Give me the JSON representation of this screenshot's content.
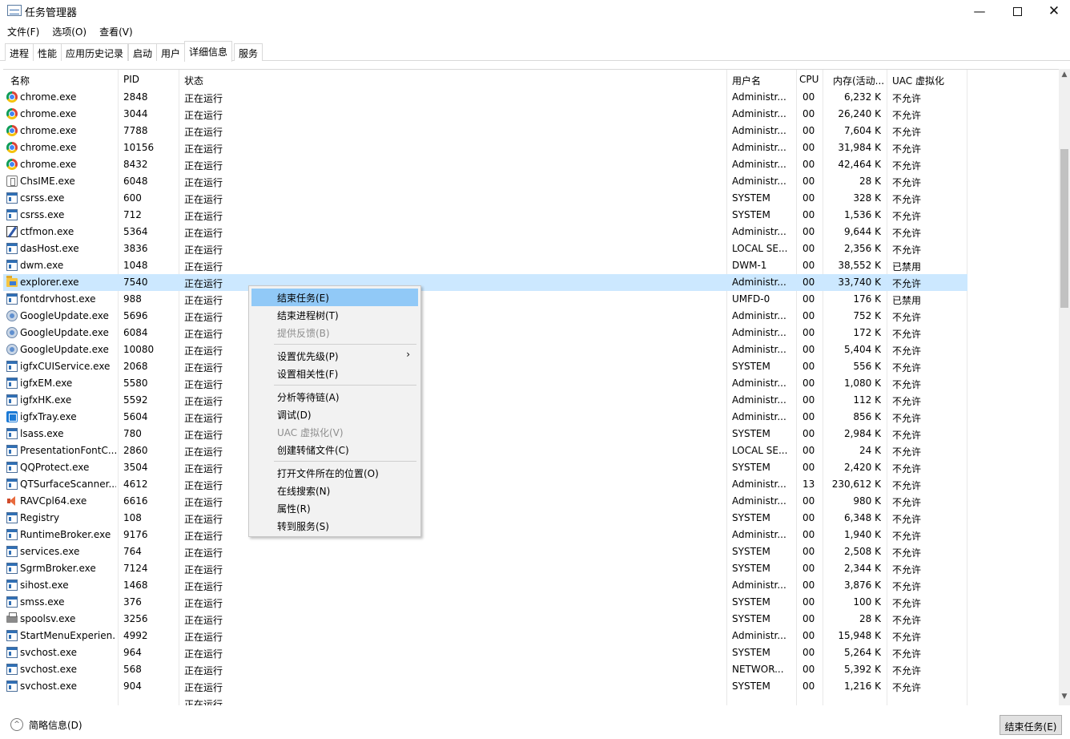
{
  "window": {
    "title": "任务管理器",
    "min_glyph": "—",
    "close_glyph": "✕"
  },
  "menu": [
    "文件(F)",
    "选项(O)",
    "查看(V)"
  ],
  "tabs": [
    "进程",
    "性能",
    "应用历史记录",
    "启动",
    "用户",
    "详细信息",
    "服务"
  ],
  "active_tab": "详细信息",
  "columns": {
    "name": "名称",
    "pid": "PID",
    "status": "状态",
    "user": "用户名",
    "cpu": "CPU",
    "mem": "内存(活动...",
    "uac": "UAC 虚拟化"
  },
  "sort_glyph": "^",
  "rows": [
    {
      "icon": "chrome-icon",
      "name": "chrome.exe",
      "pid": "2848",
      "status": "正在运行",
      "user": "Administr...",
      "cpu": "00",
      "mem": "6,232 K",
      "uac": "不允许"
    },
    {
      "icon": "chrome-icon",
      "name": "chrome.exe",
      "pid": "3044",
      "status": "正在运行",
      "user": "Administr...",
      "cpu": "00",
      "mem": "26,240 K",
      "uac": "不允许"
    },
    {
      "icon": "chrome-icon",
      "name": "chrome.exe",
      "pid": "7788",
      "status": "正在运行",
      "user": "Administr...",
      "cpu": "00",
      "mem": "7,604 K",
      "uac": "不允许"
    },
    {
      "icon": "chrome-icon",
      "name": "chrome.exe",
      "pid": "10156",
      "status": "正在运行",
      "user": "Administr...",
      "cpu": "00",
      "mem": "31,984 K",
      "uac": "不允许"
    },
    {
      "icon": "chrome-icon",
      "name": "chrome.exe",
      "pid": "8432",
      "status": "正在运行",
      "user": "Administr...",
      "cpu": "00",
      "mem": "42,464 K",
      "uac": "不允许"
    },
    {
      "icon": "ime-icon",
      "name": "ChsIME.exe",
      "pid": "6048",
      "status": "正在运行",
      "user": "Administr...",
      "cpu": "00",
      "mem": "28 K",
      "uac": "不允许"
    },
    {
      "icon": "app-window-icon",
      "name": "csrss.exe",
      "pid": "600",
      "status": "正在运行",
      "user": "SYSTEM",
      "cpu": "00",
      "mem": "328 K",
      "uac": "不允许"
    },
    {
      "icon": "app-window-icon",
      "name": "csrss.exe",
      "pid": "712",
      "status": "正在运行",
      "user": "SYSTEM",
      "cpu": "00",
      "mem": "1,536 K",
      "uac": "不允许"
    },
    {
      "icon": "ctfmon-icon",
      "name": "ctfmon.exe",
      "pid": "5364",
      "status": "正在运行",
      "user": "Administr...",
      "cpu": "00",
      "mem": "9,644 K",
      "uac": "不允许"
    },
    {
      "icon": "app-window-icon",
      "name": "dasHost.exe",
      "pid": "3836",
      "status": "正在运行",
      "user": "LOCAL SE...",
      "cpu": "00",
      "mem": "2,356 K",
      "uac": "不允许"
    },
    {
      "icon": "app-window-icon",
      "name": "dwm.exe",
      "pid": "1048",
      "status": "正在运行",
      "user": "DWM-1",
      "cpu": "00",
      "mem": "38,552 K",
      "uac": "已禁用"
    },
    {
      "icon": "explorer-folder-icon",
      "name": "explorer.exe",
      "pid": "7540",
      "status": "正在运行",
      "user": "Administr...",
      "cpu": "00",
      "mem": "33,740 K",
      "uac": "不允许",
      "selected": true
    },
    {
      "icon": "app-window-icon",
      "name": "fontdrvhost.exe",
      "pid": "988",
      "status": "正在运行",
      "user": "UMFD-0",
      "cpu": "00",
      "mem": "176 K",
      "uac": "已禁用"
    },
    {
      "icon": "google-update-icon",
      "name": "GoogleUpdate.exe",
      "pid": "5696",
      "status": "正在运行",
      "user": "Administr...",
      "cpu": "00",
      "mem": "752 K",
      "uac": "不允许"
    },
    {
      "icon": "google-update-icon",
      "name": "GoogleUpdate.exe",
      "pid": "6084",
      "status": "正在运行",
      "user": "Administr...",
      "cpu": "00",
      "mem": "172 K",
      "uac": "不允许"
    },
    {
      "icon": "google-update-icon",
      "name": "GoogleUpdate.exe",
      "pid": "10080",
      "status": "正在运行",
      "user": "Administr...",
      "cpu": "00",
      "mem": "5,404 K",
      "uac": "不允许"
    },
    {
      "icon": "app-window-icon",
      "name": "igfxCUIService.exe",
      "pid": "2068",
      "status": "正在运行",
      "user": "SYSTEM",
      "cpu": "00",
      "mem": "556 K",
      "uac": "不允许"
    },
    {
      "icon": "app-window-icon",
      "name": "igfxEM.exe",
      "pid": "5580",
      "status": "正在运行",
      "user": "Administr...",
      "cpu": "00",
      "mem": "1,080 K",
      "uac": "不允许"
    },
    {
      "icon": "app-window-icon",
      "name": "igfxHK.exe",
      "pid": "5592",
      "status": "正在运行",
      "user": "Administr...",
      "cpu": "00",
      "mem": "112 K",
      "uac": "不允许"
    },
    {
      "icon": "igfx-tray-icon",
      "name": "igfxTray.exe",
      "pid": "5604",
      "status": "正在运行",
      "user": "Administr...",
      "cpu": "00",
      "mem": "856 K",
      "uac": "不允许"
    },
    {
      "icon": "app-window-icon",
      "name": "lsass.exe",
      "pid": "780",
      "status": "正在运行",
      "user": "SYSTEM",
      "cpu": "00",
      "mem": "2,984 K",
      "uac": "不允许"
    },
    {
      "icon": "app-window-icon",
      "name": "PresentationFontC...",
      "pid": "2860",
      "status": "正在运行",
      "user": "LOCAL SE...",
      "cpu": "00",
      "mem": "24 K",
      "uac": "不允许"
    },
    {
      "icon": "app-window-icon",
      "name": "QQProtect.exe",
      "pid": "3504",
      "status": "正在运行",
      "user": "SYSTEM",
      "cpu": "00",
      "mem": "2,420 K",
      "uac": "不允许"
    },
    {
      "icon": "app-window-icon",
      "name": "QTSurfaceScanner....",
      "pid": "4612",
      "status": "正在运行",
      "user": "Administr...",
      "cpu": "13",
      "mem": "230,612 K",
      "uac": "不允许"
    },
    {
      "icon": "speaker-icon",
      "name": "RAVCpl64.exe",
      "pid": "6616",
      "status": "正在运行",
      "user": "Administr...",
      "cpu": "00",
      "mem": "980 K",
      "uac": "不允许"
    },
    {
      "icon": "app-window-icon",
      "name": "Registry",
      "pid": "108",
      "status": "正在运行",
      "user": "SYSTEM",
      "cpu": "00",
      "mem": "6,348 K",
      "uac": "不允许"
    },
    {
      "icon": "app-window-icon",
      "name": "RuntimeBroker.exe",
      "pid": "9176",
      "status": "正在运行",
      "user": "Administr...",
      "cpu": "00",
      "mem": "1,940 K",
      "uac": "不允许"
    },
    {
      "icon": "app-window-icon",
      "name": "services.exe",
      "pid": "764",
      "status": "正在运行",
      "user": "SYSTEM",
      "cpu": "00",
      "mem": "2,508 K",
      "uac": "不允许"
    },
    {
      "icon": "app-window-icon",
      "name": "SgrmBroker.exe",
      "pid": "7124",
      "status": "正在运行",
      "user": "SYSTEM",
      "cpu": "00",
      "mem": "2,344 K",
      "uac": "不允许"
    },
    {
      "icon": "app-window-icon",
      "name": "sihost.exe",
      "pid": "1468",
      "status": "正在运行",
      "user": "Administr...",
      "cpu": "00",
      "mem": "3,876 K",
      "uac": "不允许"
    },
    {
      "icon": "app-window-icon",
      "name": "smss.exe",
      "pid": "376",
      "status": "正在运行",
      "user": "SYSTEM",
      "cpu": "00",
      "mem": "100 K",
      "uac": "不允许"
    },
    {
      "icon": "printer-icon",
      "name": "spoolsv.exe",
      "pid": "3256",
      "status": "正在运行",
      "user": "SYSTEM",
      "cpu": "00",
      "mem": "28 K",
      "uac": "不允许"
    },
    {
      "icon": "app-window-icon",
      "name": "StartMenuExperien...",
      "pid": "4992",
      "status": "正在运行",
      "user": "Administr...",
      "cpu": "00",
      "mem": "15,948 K",
      "uac": "不允许"
    },
    {
      "icon": "app-window-icon",
      "name": "svchost.exe",
      "pid": "964",
      "status": "正在运行",
      "user": "SYSTEM",
      "cpu": "00",
      "mem": "5,264 K",
      "uac": "不允许"
    },
    {
      "icon": "app-window-icon",
      "name": "svchost.exe",
      "pid": "568",
      "status": "正在运行",
      "user": "NETWOR...",
      "cpu": "00",
      "mem": "5,392 K",
      "uac": "不允许"
    },
    {
      "icon": "app-window-icon",
      "name": "svchost.exe",
      "pid": "904",
      "status": "正在运行",
      "user": "SYSTEM",
      "cpu": "00",
      "mem": "1,216 K",
      "uac": "不允许"
    },
    {
      "icon": "",
      "name": "",
      "pid": "",
      "status": "正在运行",
      "user": "",
      "cpu": "",
      "mem": "",
      "uac": ""
    }
  ],
  "context_menu": [
    {
      "label": "结束任务(E)",
      "highlighted": true
    },
    {
      "label": "结束进程树(T)"
    },
    {
      "label": "提供反馈(B)",
      "disabled": true
    },
    {
      "separator": true
    },
    {
      "label": "设置优先级(P)",
      "submenu": true
    },
    {
      "label": "设置相关性(F)"
    },
    {
      "separator": true
    },
    {
      "label": "分析等待链(A)"
    },
    {
      "label": "调试(D)"
    },
    {
      "label": "UAC 虚拟化(V)",
      "disabled": true
    },
    {
      "label": "创建转储文件(C)"
    },
    {
      "separator": true
    },
    {
      "label": "打开文件所在的位置(O)"
    },
    {
      "label": "在线搜索(N)"
    },
    {
      "label": "属性(R)"
    },
    {
      "label": "转到服务(S)"
    }
  ],
  "footer": {
    "collapse_label": "简略信息(D)",
    "collapse_glyph": "^",
    "end_task_label": "结束任务(E)"
  },
  "colors": {
    "selection": "#cce8ff",
    "menu_highlight": "#91c9f7",
    "tab_border": "#d9d9d9"
  }
}
